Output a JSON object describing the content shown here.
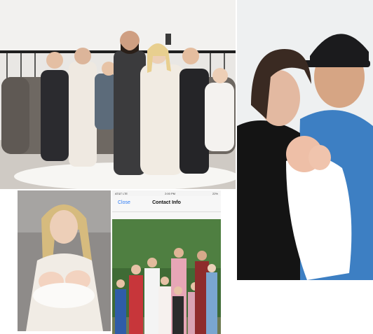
{
  "phone": {
    "carrier": "AT&T",
    "network": "LTE",
    "time": "2:00 PM",
    "battery": "22%",
    "back_label": "Close",
    "title": "Contact Info"
  },
  "photos": {
    "family_couch": "family-portrait-photo",
    "couple_baby": "couple-with-newborn-photo",
    "mother_twins": "mother-with-twins-photo",
    "children_group": "children-group-photo"
  }
}
